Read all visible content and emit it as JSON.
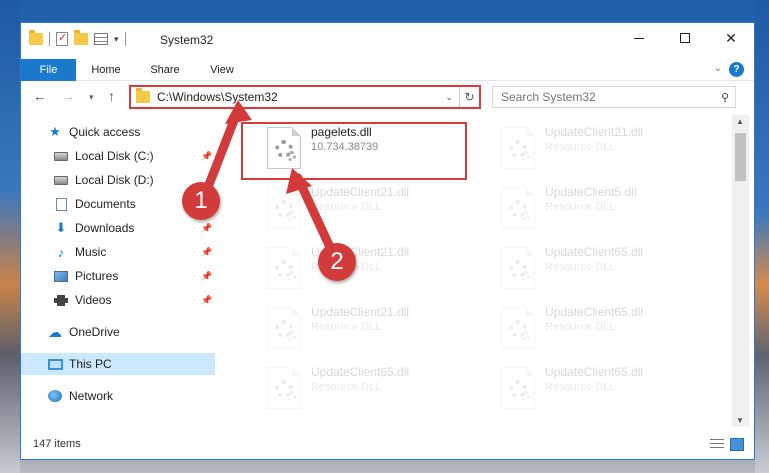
{
  "window": {
    "title": "System32",
    "controls": {
      "minimize": "—",
      "maximize": "",
      "close": "✕"
    }
  },
  "ribbon": {
    "tabs": [
      "File",
      "Home",
      "Share",
      "View"
    ],
    "help": "?"
  },
  "address": {
    "path": "C:\\Windows\\System32",
    "search_placeholder": "Search System32"
  },
  "sidebar": {
    "items": [
      {
        "label": "Quick access",
        "icon": "star-icon",
        "pinned": false
      },
      {
        "label": "Local Disk (C:)",
        "icon": "disk-icon",
        "pinned": true
      },
      {
        "label": "Local Disk (D:)",
        "icon": "disk-icon",
        "pinned": false
      },
      {
        "label": "Documents",
        "icon": "document-icon",
        "pinned": false
      },
      {
        "label": "Downloads",
        "icon": "download-icon",
        "pinned": true
      },
      {
        "label": "Music",
        "icon": "music-icon",
        "pinned": true
      },
      {
        "label": "Pictures",
        "icon": "pictures-icon",
        "pinned": true
      },
      {
        "label": "Videos",
        "icon": "videos-icon",
        "pinned": true
      },
      {
        "label": "OneDrive",
        "icon": "cloud-icon",
        "pinned": false
      },
      {
        "label": "This PC",
        "icon": "pc-icon",
        "pinned": false,
        "selected": true
      },
      {
        "label": "Network",
        "icon": "network-icon",
        "pinned": false
      }
    ]
  },
  "files": [
    {
      "name": "pagelets.dll",
      "sub": "10.734.38739"
    },
    {
      "name": "UpdateClient21.dll",
      "sub": "Resource DLL"
    },
    {
      "name": "UpdateClient21.dll",
      "sub": "Resource DLL"
    },
    {
      "name": "UpdateClient5.dll",
      "sub": "Resource DLL"
    },
    {
      "name": "UpdateClient21.dll",
      "sub": "Resource DLL"
    },
    {
      "name": "UpdateClient65.dll",
      "sub": "Resource DLL"
    },
    {
      "name": "UpdateClient21.dll",
      "sub": "Resource DLL"
    },
    {
      "name": "UpdateClient65.dll",
      "sub": "Resource DLL"
    },
    {
      "name": "UpdateClient65.dll",
      "sub": "Resource DLL"
    },
    {
      "name": "UpdateClient65.dll",
      "sub": "Resource DLL"
    }
  ],
  "status": {
    "item_count": "147 items"
  },
  "annotations": {
    "marker1": "1",
    "marker2": "2"
  },
  "colors": {
    "accent": "#1979ca",
    "highlight": "#d9393a",
    "selection": "#cce8ff"
  }
}
